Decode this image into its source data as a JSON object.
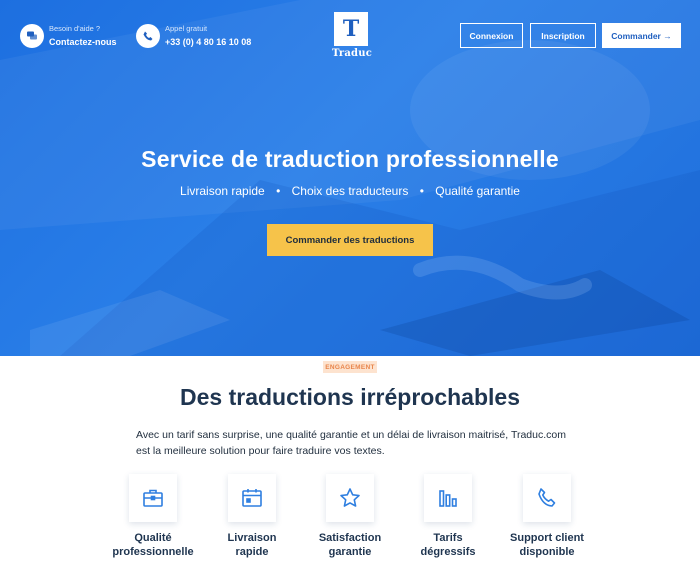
{
  "header": {
    "help": {
      "small": "Besoin d'aide ?",
      "big": "Contactez-nous",
      "icon": "chat-bubble-icon"
    },
    "phone": {
      "small": "Appel gratuit",
      "big": "+33 (0) 4 80 16 10 08",
      "icon": "phone-icon"
    },
    "logo": {
      "letter": "T",
      "name": "Traduc"
    },
    "login_label": "Connexion",
    "signup_label": "Inscription",
    "order_label": "Commander →"
  },
  "hero": {
    "title": "Service de traduction professionnelle",
    "features": [
      "Livraison rapide",
      "Choix des traducteurs",
      "Qualité garantie"
    ],
    "separator": "•",
    "cta_label": "Commander des traductions"
  },
  "section": {
    "badge": "ENGAGEMENT",
    "title": "Des traductions irréprochables",
    "text": "Avec un tarif sans surprise, une qualité garantie et un délai de livraison maitrisé, Traduc.com est la meilleure solution pour faire traduire vos textes."
  },
  "features": [
    {
      "line1": "Qualité",
      "line2": "professionnelle",
      "icon": "briefcase-icon"
    },
    {
      "line1": "Livraison",
      "line2": "rapide",
      "icon": "calendar-icon"
    },
    {
      "line1": "Satisfaction",
      "line2": "garantie",
      "icon": "star-icon"
    },
    {
      "line1": "Tarifs",
      "line2": "dégressifs",
      "icon": "bar-chart-icon"
    },
    {
      "line1": "Support client",
      "line2": "disponible",
      "icon": "phone-icon"
    }
  ],
  "colors": {
    "hero_blue": "#1f6edb",
    "cta_yellow": "#f6c34a",
    "badge_bg": "#fde3cf",
    "badge_text": "#e8844a",
    "title_navy": "#1f3550",
    "icon_blue": "#2f7fe0"
  }
}
